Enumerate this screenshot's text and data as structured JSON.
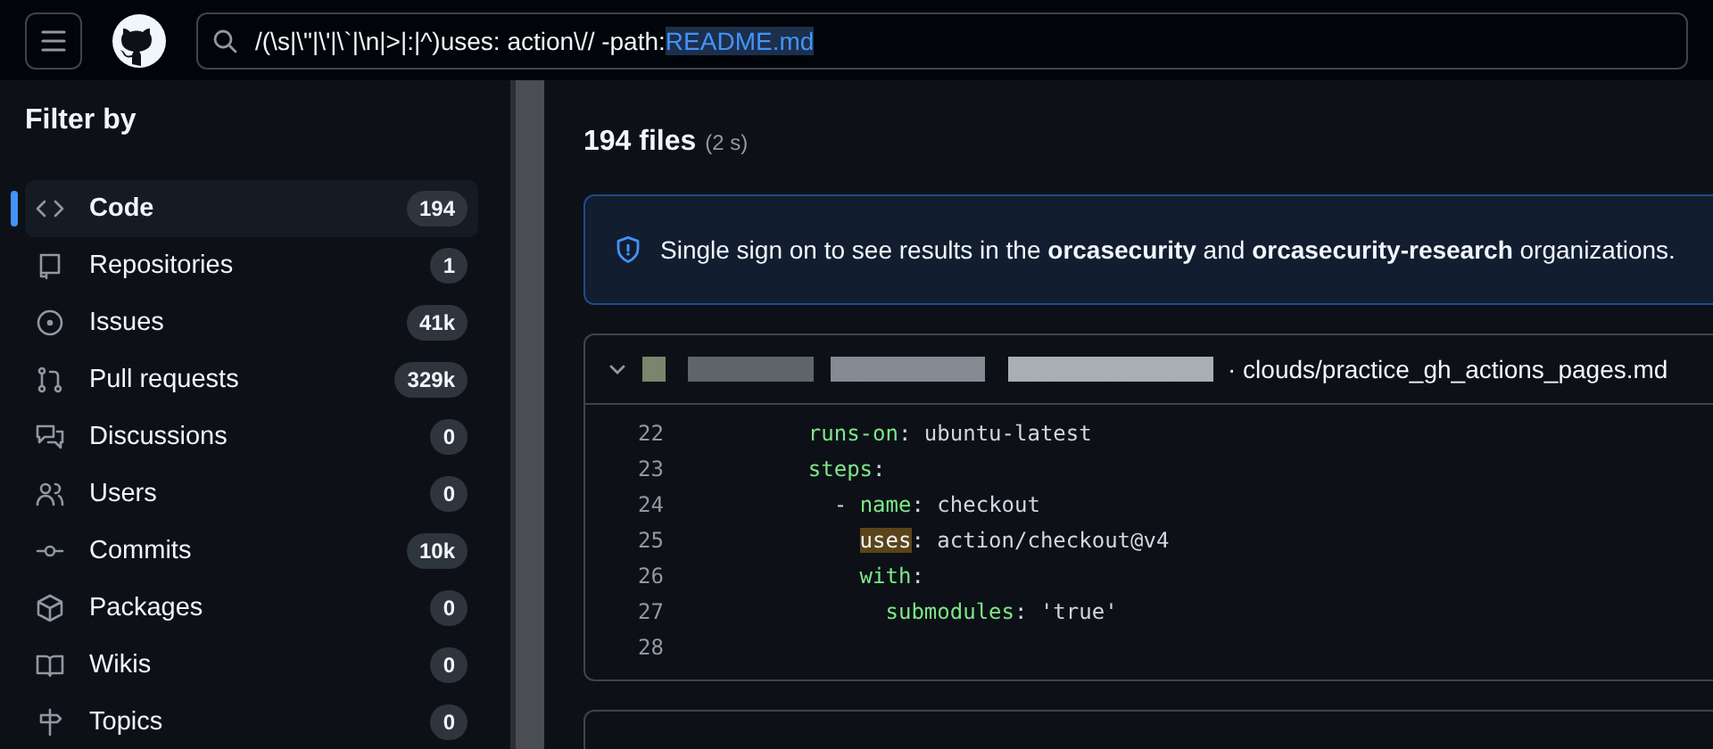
{
  "header": {
    "search": {
      "query": "/(\\s|\\\"|\\'|\\`|\\n|>|:|^)uses: action\\// -path:",
      "selected_text": "README.md"
    }
  },
  "sidebar": {
    "title": "Filter by",
    "items": [
      {
        "label": "Code",
        "count": "194",
        "selected": true
      },
      {
        "label": "Repositories",
        "count": "1",
        "selected": false
      },
      {
        "label": "Issues",
        "count": "41k",
        "selected": false
      },
      {
        "label": "Pull requests",
        "count": "329k",
        "selected": false
      },
      {
        "label": "Discussions",
        "count": "0",
        "selected": false
      },
      {
        "label": "Users",
        "count": "0",
        "selected": false
      },
      {
        "label": "Commits",
        "count": "10k",
        "selected": false
      },
      {
        "label": "Packages",
        "count": "0",
        "selected": false
      },
      {
        "label": "Wikis",
        "count": "0",
        "selected": false
      },
      {
        "label": "Topics",
        "count": "0",
        "selected": false
      }
    ]
  },
  "results": {
    "count": "194 files",
    "time": "(2 s)",
    "banner": "Single sign on to see results in the **orcasecurity** and **orcasecurity-research** organizations.",
    "file": {
      "expanded": true,
      "path": "· clouds/practice_gh_actions_pages.md",
      "lines": [
        {
          "number": "22",
          "tokens": [
            {
              "kind": "key",
              "text": "    runs-on"
            },
            {
              "kind": "plain",
              "text": ": ubuntu-latest"
            }
          ]
        },
        {
          "number": "23",
          "tokens": [
            {
              "kind": "key",
              "text": "    steps"
            },
            {
              "kind": "plain",
              "text": ":"
            }
          ]
        },
        {
          "number": "24",
          "tokens": [
            {
              "kind": "plain",
              "text": "      - "
            },
            {
              "kind": "key",
              "text": "name"
            },
            {
              "kind": "plain",
              "text": ": checkout"
            }
          ]
        },
        {
          "number": "25",
          "tokens": [
            {
              "kind": "match",
              "text": "        uses"
            },
            {
              "kind": "plain",
              "text": ": action/checkout@v4"
            }
          ]
        },
        {
          "number": "26",
          "tokens": [
            {
              "kind": "key",
              "text": "        with"
            },
            {
              "kind": "plain",
              "text": ":"
            }
          ]
        },
        {
          "number": "27",
          "tokens": [
            {
              "kind": "key",
              "text": "          submodules"
            },
            {
              "kind": "plain",
              "text": ": 'true'"
            }
          ]
        },
        {
          "number": "28"
        }
      ]
    }
  }
}
